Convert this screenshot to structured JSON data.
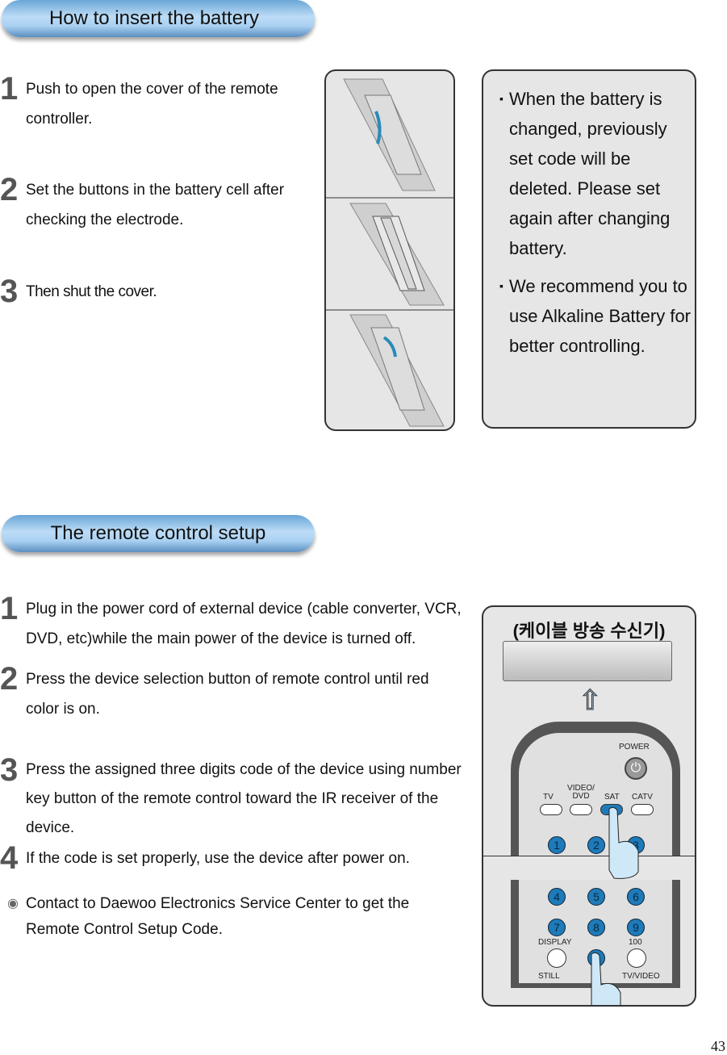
{
  "battery_section": {
    "title": "How to insert the battery",
    "steps": [
      {
        "num": "1",
        "text": "Push to open the cover of the remote controller."
      },
      {
        "num": "2",
        "text": "Set the buttons in the battery cell after checking the electrode."
      },
      {
        "num": "3",
        "text": "Then shut the cover."
      }
    ],
    "notes": [
      "When the battery is changed, previously set code will be deleted. Please set again after changing battery.",
      "We recommend you to use Alkaline Battery for better controlling."
    ]
  },
  "setup_section": {
    "title": "The remote control setup",
    "steps": [
      {
        "num": "1",
        "text": "Plug in the power cord of external device (cable converter, VCR, DVD, etc)while the main power of the device is turned off."
      },
      {
        "num": "2",
        "text": "Press the device selection button of remote control until red color is on."
      },
      {
        "num": "3",
        "text": "Press the assigned three digits code of the device using number key button of the remote control toward the IR receiver of the device."
      },
      {
        "num": "4",
        "text": "If the code is set properly, use the device after power on."
      }
    ],
    "contact": "Contact to Daewoo Electronics Service Center to get the Remote Control Setup Code."
  },
  "illustration": {
    "caption": "(케이블 방송 수신기)",
    "power": "POWER",
    "devices": [
      "TV",
      "VIDEO/ DVD",
      "SAT",
      "CATV"
    ],
    "keys": [
      "1",
      "2",
      "3",
      "4",
      "5",
      "6",
      "7",
      "8",
      "9",
      "0"
    ],
    "display": "DISPLAY",
    "hundred": "100",
    "still": "STILL",
    "tvvideo": "TV/VIDEO"
  },
  "page_number": "43"
}
